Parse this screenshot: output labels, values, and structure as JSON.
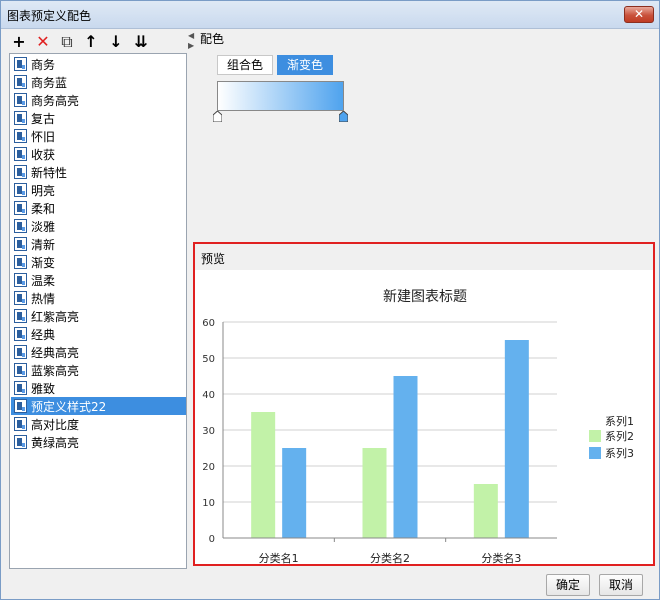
{
  "window": {
    "title": "图表预定义配色",
    "close_label": "✕"
  },
  "toolbar": {
    "buttons": [
      {
        "name": "add-icon",
        "glyph": "+"
      },
      {
        "name": "delete-icon",
        "glyph": "✕"
      },
      {
        "name": "copy-icon",
        "glyph": "⧉"
      },
      {
        "name": "move-up-icon",
        "glyph": "↑"
      },
      {
        "name": "move-down-icon",
        "glyph": "↓"
      },
      {
        "name": "sort-icon",
        "glyph": "⇊"
      }
    ]
  },
  "styles_list": {
    "items": [
      "商务",
      "商务蓝",
      "商务高亮",
      "复古",
      "怀旧",
      "收获",
      "新特性",
      "明亮",
      "柔和",
      "淡雅",
      "清新",
      "渐变",
      "温柔",
      "热情",
      "红紫高亮",
      "经典",
      "经典高亮",
      "蓝紫高亮",
      "雅致",
      "预定义样式22",
      "高对比度",
      "黄绿高亮"
    ],
    "selected_index": 19
  },
  "color_section": {
    "label": "配色",
    "tabs": [
      {
        "label": "组合色",
        "active": false
      },
      {
        "label": "渐变色",
        "active": true
      }
    ],
    "gradient": {
      "start": "#ffffff",
      "end": "#4fa3ee"
    }
  },
  "preview": {
    "label": "预览"
  },
  "chart_data": {
    "type": "bar",
    "title": "新建图表标题",
    "categories": [
      "分类名1",
      "分类名2",
      "分类名3"
    ],
    "legend_title": "系列1",
    "legend_position": "right",
    "series": [
      {
        "name": "系列1",
        "values": [],
        "color": ""
      },
      {
        "name": "系列2",
        "values": [
          35,
          25,
          15
        ],
        "color": "#c2f2a8"
      },
      {
        "name": "系列3",
        "values": [
          25,
          45,
          55
        ],
        "color": "#64b1ee"
      }
    ],
    "ylim": [
      0,
      60
    ],
    "yticks": [
      0,
      10,
      20,
      30,
      40,
      50,
      60
    ],
    "grid": true
  },
  "buttons": {
    "ok": "确定",
    "cancel": "取消"
  },
  "colors": {
    "selection": "#3d8ee0",
    "highlight_border": "#e02020"
  }
}
